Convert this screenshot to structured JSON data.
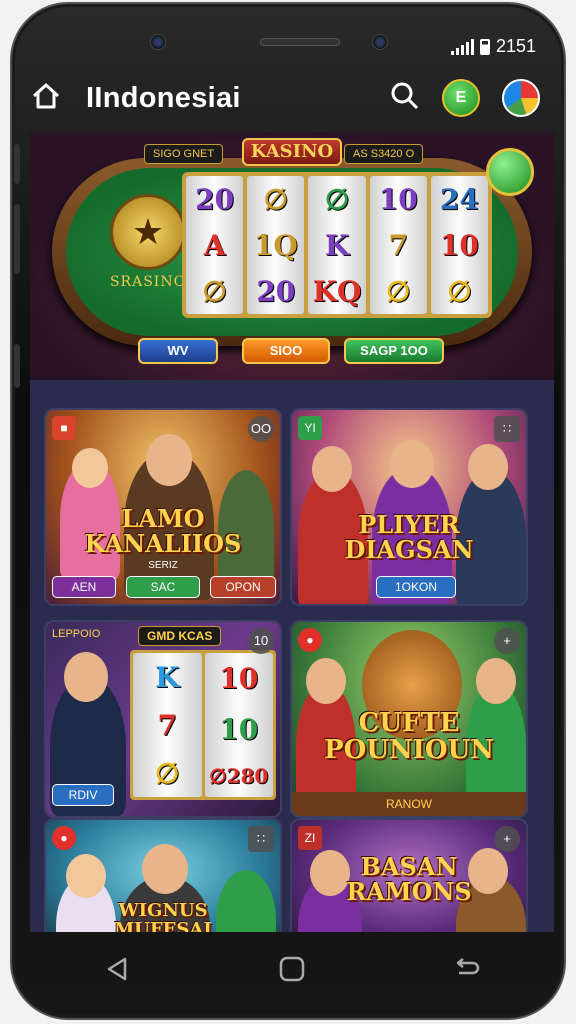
{
  "status_bar": {
    "time": "2151"
  },
  "app_bar": {
    "title": "IIndonesiai"
  },
  "hero": {
    "sign": "KASINO",
    "left_sign": "SIGO GNET",
    "right_sign": "AS S3420 O",
    "emblem_label": "SRASINO",
    "reels": [
      [
        "20",
        "∅",
        "A",
        "∅"
      ],
      [
        "∅",
        "1Q",
        "20"
      ],
      [
        "∅",
        "K",
        "KQ"
      ],
      [
        "10",
        "7",
        "∅"
      ],
      [
        "24",
        "10",
        "∅"
      ]
    ],
    "buttons": [
      "WV",
      "SIOO",
      "SAGP 1OO"
    ]
  },
  "cards": [
    {
      "title_line1": "LAMO",
      "title_line2": "KANALIIOS",
      "sub": "SERIZ",
      "pills": [
        "AEN",
        "SAC",
        "OPON"
      ],
      "corner": "OO"
    },
    {
      "title_line1": "PLIYER",
      "title_line2": "DIAGSAN",
      "pills": [
        "1OKON"
      ],
      "corner": "∷",
      "corner_left": "YI"
    },
    {
      "title": "GMD KCAS",
      "corner_left": "LEPPOIO",
      "reels": [
        [
          "K",
          "7",
          "∅"
        ],
        [
          "10",
          "10",
          "∅280"
        ]
      ],
      "pills": [
        "RDIV"
      ],
      "corner": "10"
    },
    {
      "title_line1": "CUFTE",
      "title_line2": "POUNIOUN",
      "pills": [
        "RANOW"
      ],
      "corner": "+"
    },
    {
      "title_line1": "WIGNUS",
      "title_line2": "MUFESAI",
      "corner": "∷"
    },
    {
      "title_line1": "BASAN",
      "title_line2": "RAMONS",
      "corner": "+",
      "corner_left": "ZI"
    }
  ],
  "colors": {
    "accent_gold": "#ffd34d",
    "felt_green": "#1f8a3c",
    "screen_bg": "#2a2c4e"
  }
}
